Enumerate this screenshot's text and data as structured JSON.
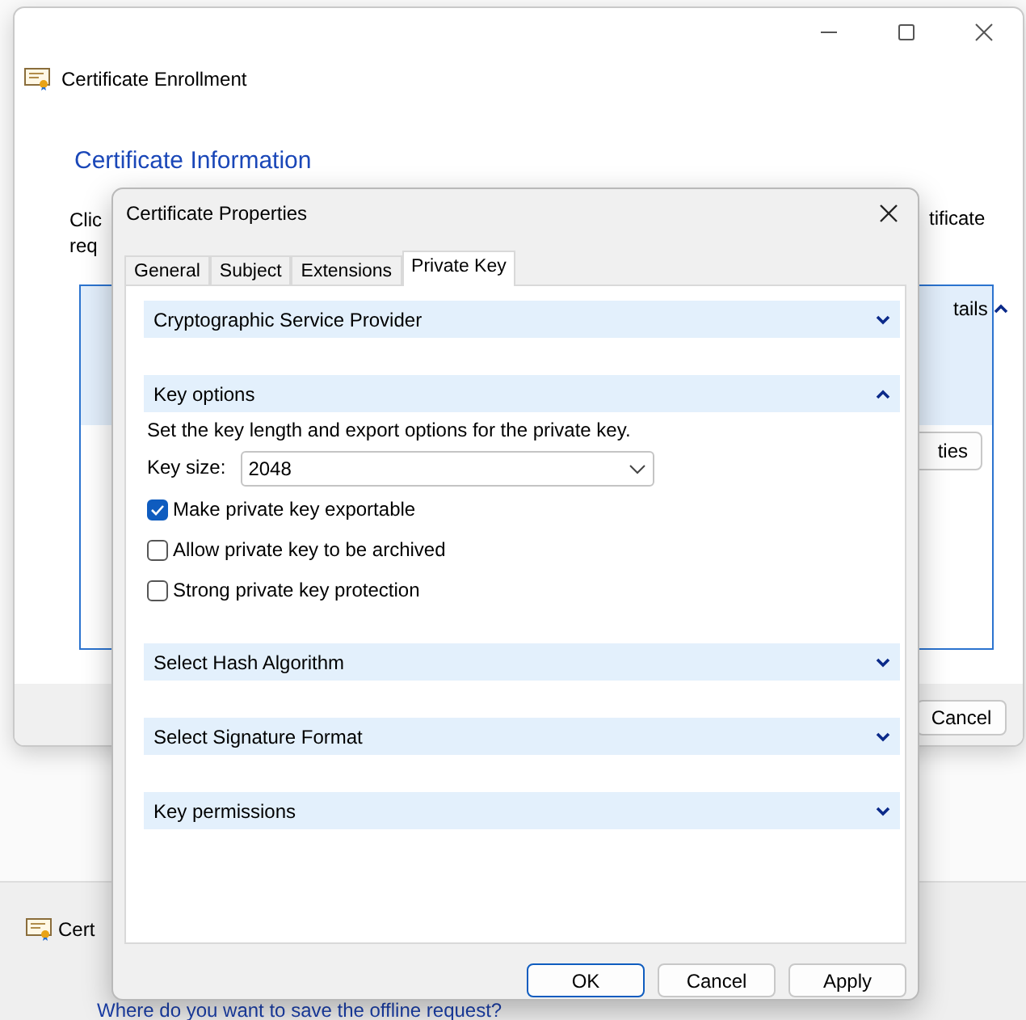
{
  "back_window": {
    "title": "Cert",
    "heading": "Where do you want to save the offline request?"
  },
  "main_window": {
    "title": "Certificate Enrollment",
    "heading": "Certificate Information",
    "intro_lines": [
      "Clic",
      "req"
    ],
    "intro_right": "tificate",
    "details_link": "tails",
    "properties_button": "ties",
    "cancel_button": "Cancel"
  },
  "dialog": {
    "title": "Certificate Properties",
    "tabs": [
      {
        "label": "General",
        "selected": false
      },
      {
        "label": "Subject",
        "selected": false
      },
      {
        "label": "Extensions",
        "selected": false
      },
      {
        "label": "Private Key",
        "selected": true
      }
    ],
    "sections": [
      {
        "title": "Cryptographic Service Provider",
        "expanded": false
      },
      {
        "title": "Key options",
        "expanded": true,
        "description": "Set the key length and export options for the private key.",
        "key_size": {
          "label": "Key size:",
          "value": "2048"
        },
        "options": [
          {
            "label": "Make private key exportable",
            "checked": true
          },
          {
            "label": "Allow private key to be archived",
            "checked": false
          },
          {
            "label": "Strong private key protection",
            "checked": false
          }
        ]
      },
      {
        "title": "Select Hash Algorithm",
        "expanded": false
      },
      {
        "title": "Select Signature Format",
        "expanded": false
      },
      {
        "title": "Key permissions",
        "expanded": false
      }
    ],
    "buttons": [
      {
        "label": "OK",
        "kind": "default"
      },
      {
        "label": "Cancel",
        "kind": "normal"
      },
      {
        "label": "Apply",
        "kind": "normal"
      }
    ]
  }
}
